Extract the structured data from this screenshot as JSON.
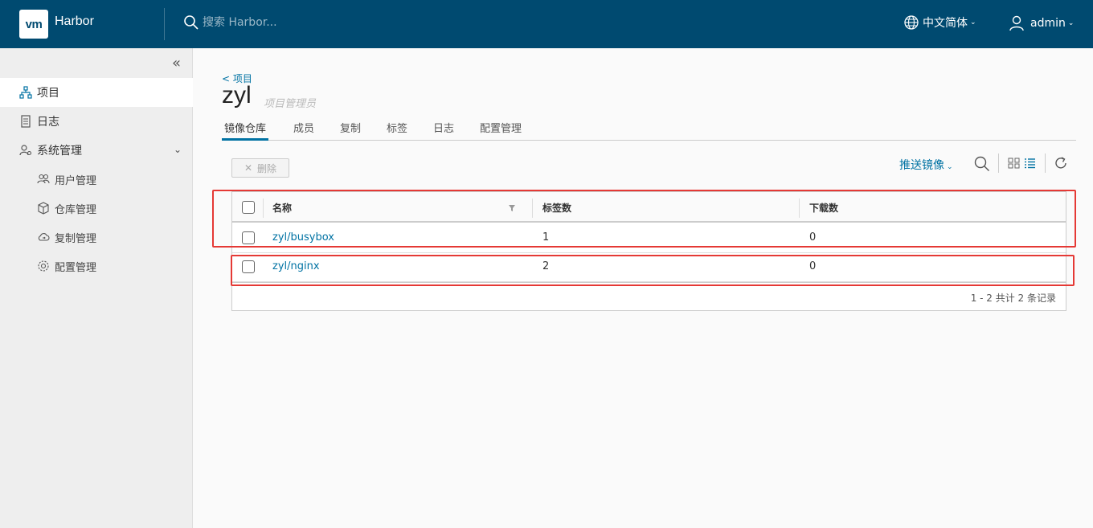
{
  "header": {
    "logo_text": "vm",
    "brand": "Harbor",
    "search_placeholder": "搜索 Harbor...",
    "language": "中文简体",
    "user": "admin"
  },
  "sidebar": {
    "items": [
      {
        "label": "项目",
        "icon": "projects-icon"
      },
      {
        "label": "日志",
        "icon": "logs-icon"
      },
      {
        "label": "系统管理",
        "icon": "admin-icon"
      },
      {
        "label": "用户管理",
        "icon": "users-icon"
      },
      {
        "label": "仓库管理",
        "icon": "registry-icon"
      },
      {
        "label": "复制管理",
        "icon": "replication-icon"
      },
      {
        "label": "配置管理",
        "icon": "config-icon"
      }
    ]
  },
  "main": {
    "breadcrumb": "< 项目",
    "project_name": "zyl",
    "role": "项目管理员",
    "tabs": [
      "镜像仓库",
      "成员",
      "复制",
      "标签",
      "日志",
      "配置管理"
    ],
    "delete_label": "删除",
    "push_label": "推送镜像"
  },
  "table": {
    "columns": [
      "名称",
      "标签数",
      "下载数"
    ],
    "rows": [
      {
        "name": "zyl/busybox",
        "tags": "1",
        "pulls": "0"
      },
      {
        "name": "zyl/nginx",
        "tags": "2",
        "pulls": "0"
      }
    ],
    "footer": "1 - 2 共计 2 条记录"
  },
  "colors": {
    "header_bg": "#004a70",
    "link": "#0072a3",
    "annotation": "#e53935"
  }
}
